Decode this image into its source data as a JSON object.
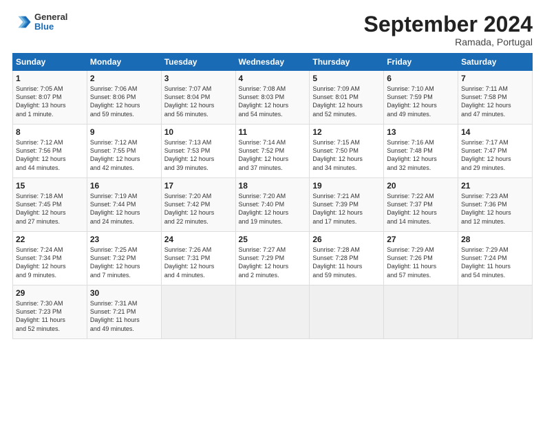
{
  "logo": {
    "general": "General",
    "blue": "Blue"
  },
  "header": {
    "month": "September 2024",
    "location": "Ramada, Portugal"
  },
  "days_of_week": [
    "Sunday",
    "Monday",
    "Tuesday",
    "Wednesday",
    "Thursday",
    "Friday",
    "Saturday"
  ],
  "weeks": [
    [
      {
        "day": "1",
        "info": "Sunrise: 7:05 AM\nSunset: 8:07 PM\nDaylight: 13 hours\nand 1 minute."
      },
      {
        "day": "2",
        "info": "Sunrise: 7:06 AM\nSunset: 8:06 PM\nDaylight: 12 hours\nand 59 minutes."
      },
      {
        "day": "3",
        "info": "Sunrise: 7:07 AM\nSunset: 8:04 PM\nDaylight: 12 hours\nand 56 minutes."
      },
      {
        "day": "4",
        "info": "Sunrise: 7:08 AM\nSunset: 8:03 PM\nDaylight: 12 hours\nand 54 minutes."
      },
      {
        "day": "5",
        "info": "Sunrise: 7:09 AM\nSunset: 8:01 PM\nDaylight: 12 hours\nand 52 minutes."
      },
      {
        "day": "6",
        "info": "Sunrise: 7:10 AM\nSunset: 7:59 PM\nDaylight: 12 hours\nand 49 minutes."
      },
      {
        "day": "7",
        "info": "Sunrise: 7:11 AM\nSunset: 7:58 PM\nDaylight: 12 hours\nand 47 minutes."
      }
    ],
    [
      {
        "day": "8",
        "info": "Sunrise: 7:12 AM\nSunset: 7:56 PM\nDaylight: 12 hours\nand 44 minutes."
      },
      {
        "day": "9",
        "info": "Sunrise: 7:12 AM\nSunset: 7:55 PM\nDaylight: 12 hours\nand 42 minutes."
      },
      {
        "day": "10",
        "info": "Sunrise: 7:13 AM\nSunset: 7:53 PM\nDaylight: 12 hours\nand 39 minutes."
      },
      {
        "day": "11",
        "info": "Sunrise: 7:14 AM\nSunset: 7:52 PM\nDaylight: 12 hours\nand 37 minutes."
      },
      {
        "day": "12",
        "info": "Sunrise: 7:15 AM\nSunset: 7:50 PM\nDaylight: 12 hours\nand 34 minutes."
      },
      {
        "day": "13",
        "info": "Sunrise: 7:16 AM\nSunset: 7:48 PM\nDaylight: 12 hours\nand 32 minutes."
      },
      {
        "day": "14",
        "info": "Sunrise: 7:17 AM\nSunset: 7:47 PM\nDaylight: 12 hours\nand 29 minutes."
      }
    ],
    [
      {
        "day": "15",
        "info": "Sunrise: 7:18 AM\nSunset: 7:45 PM\nDaylight: 12 hours\nand 27 minutes."
      },
      {
        "day": "16",
        "info": "Sunrise: 7:19 AM\nSunset: 7:44 PM\nDaylight: 12 hours\nand 24 minutes."
      },
      {
        "day": "17",
        "info": "Sunrise: 7:20 AM\nSunset: 7:42 PM\nDaylight: 12 hours\nand 22 minutes."
      },
      {
        "day": "18",
        "info": "Sunrise: 7:20 AM\nSunset: 7:40 PM\nDaylight: 12 hours\nand 19 minutes."
      },
      {
        "day": "19",
        "info": "Sunrise: 7:21 AM\nSunset: 7:39 PM\nDaylight: 12 hours\nand 17 minutes."
      },
      {
        "day": "20",
        "info": "Sunrise: 7:22 AM\nSunset: 7:37 PM\nDaylight: 12 hours\nand 14 minutes."
      },
      {
        "day": "21",
        "info": "Sunrise: 7:23 AM\nSunset: 7:36 PM\nDaylight: 12 hours\nand 12 minutes."
      }
    ],
    [
      {
        "day": "22",
        "info": "Sunrise: 7:24 AM\nSunset: 7:34 PM\nDaylight: 12 hours\nand 9 minutes."
      },
      {
        "day": "23",
        "info": "Sunrise: 7:25 AM\nSunset: 7:32 PM\nDaylight: 12 hours\nand 7 minutes."
      },
      {
        "day": "24",
        "info": "Sunrise: 7:26 AM\nSunset: 7:31 PM\nDaylight: 12 hours\nand 4 minutes."
      },
      {
        "day": "25",
        "info": "Sunrise: 7:27 AM\nSunset: 7:29 PM\nDaylight: 12 hours\nand 2 minutes."
      },
      {
        "day": "26",
        "info": "Sunrise: 7:28 AM\nSunset: 7:28 PM\nDaylight: 11 hours\nand 59 minutes."
      },
      {
        "day": "27",
        "info": "Sunrise: 7:29 AM\nSunset: 7:26 PM\nDaylight: 11 hours\nand 57 minutes."
      },
      {
        "day": "28",
        "info": "Sunrise: 7:29 AM\nSunset: 7:24 PM\nDaylight: 11 hours\nand 54 minutes."
      }
    ],
    [
      {
        "day": "29",
        "info": "Sunrise: 7:30 AM\nSunset: 7:23 PM\nDaylight: 11 hours\nand 52 minutes."
      },
      {
        "day": "30",
        "info": "Sunrise: 7:31 AM\nSunset: 7:21 PM\nDaylight: 11 hours\nand 49 minutes."
      },
      {
        "day": "",
        "info": ""
      },
      {
        "day": "",
        "info": ""
      },
      {
        "day": "",
        "info": ""
      },
      {
        "day": "",
        "info": ""
      },
      {
        "day": "",
        "info": ""
      }
    ]
  ]
}
